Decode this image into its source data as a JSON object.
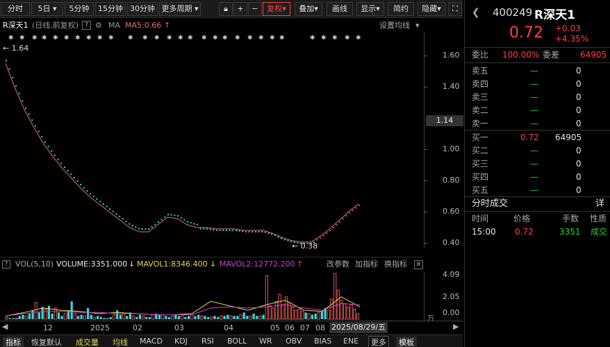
{
  "toolbar": {
    "left": [
      "分时",
      "5日",
      "5分钟",
      "15分钟",
      "30分钟",
      "更多周期"
    ],
    "right": [
      "复权",
      "叠加",
      "画线",
      "显示",
      "简约",
      "隐藏"
    ],
    "plus": "+",
    "minus": "−"
  },
  "chart_header": {
    "name": "R深天1",
    "mode": "(日线,前复权)",
    "help": "?",
    "ma_label": "MA",
    "ma5": "MA5:0.66",
    "settings": "设置均线"
  },
  "price_chart": {
    "yticks": [
      "1.60",
      "1.40",
      "1.20",
      "1.00",
      "0.80",
      "0.60",
      "0.40"
    ],
    "current_price_tag": "1.14",
    "high_label": "1.64",
    "low_label": "0.38"
  },
  "volume": {
    "title": "VOL(5,10)",
    "volume": "VOLUME:3351.000",
    "mavol1": "MAVOL1:8346.400",
    "mavol2": "MAVOL2:12772.200",
    "actions": [
      "改参数",
      "加指标",
      "换指标"
    ],
    "yticks": [
      "4.09",
      "2.05",
      "0.00"
    ],
    "unit": "万"
  },
  "xaxis": [
    "12",
    "2025",
    "02",
    "03",
    "04",
    "05",
    "06",
    "07",
    "08"
  ],
  "date_tag": "2025/08/29/五",
  "bottom_tabs": [
    "指标",
    "恢复默认",
    "成交量",
    "均线",
    "MACD",
    "KDJ",
    "RSI",
    "BOLL",
    "WR",
    "OBV",
    "BIAS",
    "ENE",
    "更多",
    "模板"
  ],
  "quote": {
    "code": "400249",
    "name": "R深天1",
    "price": "0.72",
    "change": "+0.03",
    "pct": "+4.35%",
    "weibi_label": "委比",
    "weibi": "100.00%",
    "weicha_label": "委差",
    "weicha": "64905",
    "asks": [
      {
        "label": "卖五",
        "price": "—",
        "vol": "0"
      },
      {
        "label": "卖四",
        "price": "—",
        "vol": "0"
      },
      {
        "label": "卖三",
        "price": "—",
        "vol": "0"
      },
      {
        "label": "卖二",
        "price": "—",
        "vol": "0"
      },
      {
        "label": "卖一",
        "price": "—",
        "vol": "0"
      }
    ],
    "bids": [
      {
        "label": "买一",
        "price": "0.72",
        "vol": "64905"
      },
      {
        "label": "买二",
        "price": "—",
        "vol": "0"
      },
      {
        "label": "买三",
        "price": "—",
        "vol": "0"
      },
      {
        "label": "买四",
        "price": "—",
        "vol": "0"
      },
      {
        "label": "买五",
        "price": "—",
        "vol": "0"
      }
    ],
    "ticks_title": "分时成交",
    "ticks_more": "详",
    "ticks_head": [
      "时间",
      "价格",
      "手数",
      "性质"
    ],
    "ticks": [
      {
        "time": "15:00",
        "price": "0.72",
        "vol": "3351",
        "type": "成交"
      }
    ]
  },
  "colors": {
    "up": "#ff4040",
    "down": "#2cd22c",
    "ma": "#e07070",
    "vol_up": "#e25555",
    "vol_down": "#34d7e0"
  },
  "chart_data": [
    {
      "type": "line",
      "series": [
        {
          "name": "MA5",
          "values": [
            1.62,
            1.45,
            1.3,
            1.18,
            1.07,
            0.98,
            0.9,
            0.83,
            0.76,
            0.7,
            0.65,
            0.6,
            0.55,
            0.5,
            0.47,
            0.47,
            0.52,
            0.57,
            0.56,
            0.52,
            0.5,
            0.5,
            0.49,
            0.49,
            0.49,
            0.48,
            0.48,
            0.48,
            0.46,
            0.43,
            0.41,
            0.4,
            0.4,
            0.44,
            0.49,
            0.55,
            0.61,
            0.66
          ]
        }
      ],
      "ylim": [
        0.38,
        1.66
      ]
    },
    {
      "type": "bar",
      "series": [
        {
          "name": "VOLUME",
          "values": [
            0.2,
            0.1,
            0.1,
            0.1,
            0.3,
            0.4,
            0.3,
            0.5,
            0.8,
            1.5,
            0.6,
            1.1,
            0.9,
            1.2,
            0.5,
            1.0,
            0.6,
            0.3,
            0.5,
            0.8,
            1.6,
            0.5,
            0.3,
            0.4,
            0.3,
            1.0,
            0.4,
            0.2,
            0.3,
            0.2,
            0.1,
            0.1,
            0.2,
            0.4,
            0.8,
            0.4,
            0.5,
            0.3,
            0.6,
            0.3,
            0.2,
            0.4,
            0.3,
            0.2,
            0.2,
            0.4,
            0.5,
            0.4,
            0.4,
            0.3,
            0.2,
            0.3,
            0.4,
            0.3,
            0.3,
            0.2,
            0.3,
            0.4,
            0.3,
            0.4,
            0.3,
            0.3,
            0.2,
            0.2,
            0.3,
            0.2,
            0.3,
            0.3,
            0.4,
            0.3,
            0.3,
            0.3,
            0.4,
            0.6,
            0.3,
            0.3,
            0.5,
            0.3,
            0.3,
            0.4,
            3.9,
            1.2,
            1.0,
            1.6,
            2.2,
            1.3,
            2.0,
            1.5,
            1.1,
            0.8,
            0.9,
            0.7,
            0.6,
            0.5,
            0.4,
            0.5,
            0.6,
            0.7,
            1.0,
            0.8,
            1.8,
            4.09,
            2.6,
            1.7,
            1.4,
            1.1,
            1.3,
            0.9,
            0.5
          ]
        },
        {
          "name": "MAVOL1",
          "values": [
            0.3,
            0.6,
            1.0,
            0.8,
            0.7,
            0.5,
            0.6,
            0.5,
            0.4,
            0.4,
            0.5,
            1.6,
            1.2,
            0.8,
            1.3,
            1.7,
            0.8,
            0.7,
            2.0,
            1.1
          ]
        },
        {
          "name": "MAVOL2",
          "values": [
            0.3,
            0.5,
            0.7,
            0.7,
            0.6,
            0.6,
            0.5,
            0.5,
            0.4,
            0.4,
            0.4,
            1.0,
            1.1,
            1.0,
            1.1,
            1.3,
            1.0,
            0.8,
            1.4,
            1.28
          ]
        }
      ],
      "ylim": [
        0,
        4.09
      ]
    }
  ]
}
